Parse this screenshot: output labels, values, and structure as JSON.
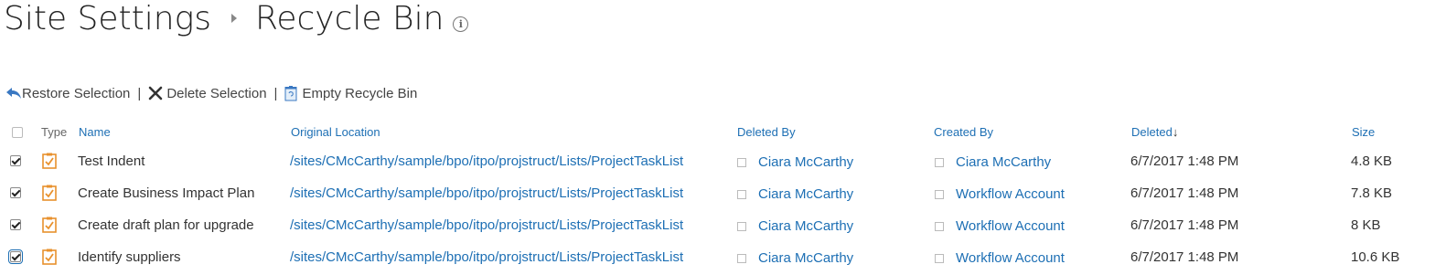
{
  "page": {
    "breadcrumb_parent": "Site Settings",
    "title": "Recycle Bin"
  },
  "toolbar": {
    "restore_label": "Restore Selection",
    "delete_label": "Delete Selection",
    "empty_label": "Empty Recycle Bin",
    "separator": "|"
  },
  "table": {
    "columns": {
      "type": "Type",
      "name": "Name",
      "original_location": "Original Location",
      "deleted_by": "Deleted By",
      "created_by": "Created By",
      "deleted": "Deleted",
      "size": "Size"
    },
    "sort_indicator": "↓",
    "rows": [
      {
        "checked": true,
        "name": "Test Indent",
        "original_location": "/sites/CMcCarthy/sample/bpo/itpo/projstruct/Lists/ProjectTaskList",
        "deleted_by": "Ciara McCarthy",
        "created_by": "Ciara McCarthy",
        "deleted": "6/7/2017 1:48 PM",
        "size": "4.8 KB"
      },
      {
        "checked": true,
        "name": "Create Business Impact Plan",
        "original_location": "/sites/CMcCarthy/sample/bpo/itpo/projstruct/Lists/ProjectTaskList",
        "deleted_by": "Ciara McCarthy",
        "created_by": "Workflow Account",
        "deleted": "6/7/2017 1:48 PM",
        "size": "7.8 KB"
      },
      {
        "checked": true,
        "name": "Create draft plan for upgrade",
        "original_location": "/sites/CMcCarthy/sample/bpo/itpo/projstruct/Lists/ProjectTaskList",
        "deleted_by": "Ciara McCarthy",
        "created_by": "Workflow Account",
        "deleted": "6/7/2017 1:48 PM",
        "size": "8 KB"
      },
      {
        "checked": true,
        "name": "Identify suppliers",
        "original_location": "/sites/CMcCarthy/sample/bpo/itpo/projstruct/Lists/ProjectTaskList",
        "deleted_by": "Ciara McCarthy",
        "created_by": "Workflow Account",
        "deleted": "6/7/2017 1:48 PM",
        "size": "10.6 KB"
      }
    ]
  },
  "colors": {
    "link": "#1d6fb4",
    "text": "#333333",
    "icon_orange": "#e8912d"
  },
  "icons": {
    "info": "info-icon",
    "restore": "undo-arrow-icon",
    "delete": "x-icon",
    "empty": "recycle-bin-icon",
    "row_type": "task-list-icon"
  }
}
